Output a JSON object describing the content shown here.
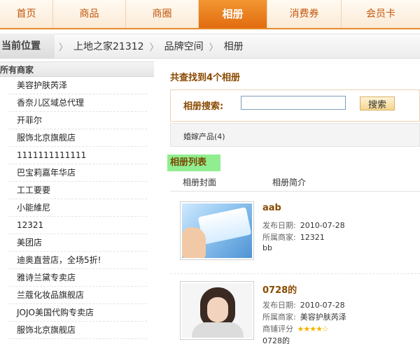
{
  "nav": [
    "首页",
    "商品",
    "商圈",
    "相册",
    "消费券",
    "会员卡"
  ],
  "breadcrumb": {
    "lead": "当前位置",
    "items": [
      "上地之家21312",
      "品牌空间",
      "相册"
    ]
  },
  "sidebar": {
    "title": "所有商家",
    "merchants": [
      "美容护肤芮泽",
      "香奈儿区域总代理",
      "开菲尔",
      "服饰北京旗舰店",
      "1111111111111",
      "巴宝莉嘉年华店",
      "工工要要",
      "小能維尼",
      "12321",
      "美团店",
      "迪奥直营店，全场5折!",
      "雅诗兰黛专卖店",
      "兰蔻化妆品旗舰店",
      "JOJO美国代购专卖店",
      "服饰北京旗舰店"
    ]
  },
  "main": {
    "found_text": "共查找到4个相册",
    "search_label": "相册搜索:",
    "search_value": "",
    "search_button": "搜索",
    "category": "婚嫁产品(4)",
    "list_title": "相册列表",
    "col_cover": "相册封面",
    "col_intro": "相册简介",
    "albums": [
      {
        "title": "aab",
        "date_label": "发布日期:",
        "date": "2010-07-28",
        "merchant_label": "所属商家:",
        "merchant": "12321",
        "desc": "bb"
      },
      {
        "title": "0728的",
        "date_label": "发布日期:",
        "date": "2010-07-28",
        "merchant_label": "所属商家:",
        "merchant": "美容护肤芮泽",
        "rating_label": "商铺评分",
        "rating": 4,
        "desc": "0728的"
      }
    ]
  }
}
